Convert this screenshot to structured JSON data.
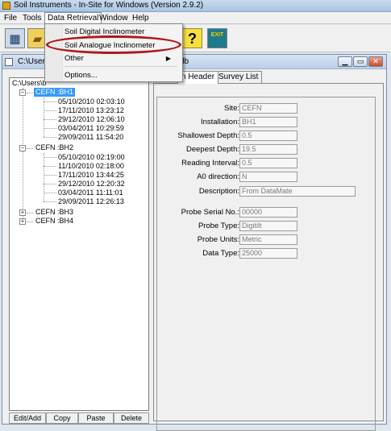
{
  "window": {
    "title": "Soil Instruments - In-Site for Windows (Version 2.9.2)"
  },
  "menubar": {
    "items": [
      "File",
      "Tools",
      "Data Retrieval",
      "Window",
      "Help"
    ]
  },
  "dropdown": {
    "items": [
      "Soil Digital Inclinometer",
      "Soil Analogue Inclinometer",
      "Other",
      "Options..."
    ]
  },
  "toolbar": {
    "exit_label": "EXIT"
  },
  "child_window": {
    "title": "C:\\Users\\",
    "title_suffix": "db"
  },
  "tabs": [
    "n Header",
    "Survey List"
  ],
  "tree": {
    "root": "C:\\Users\\b",
    "nodes": [
      {
        "label": "CEFN :BH1",
        "dates": [
          "05/10/2010 02:03:10",
          "17/11/2010 13:23:12",
          "29/12/2010 12:06:10",
          "03/04/2011 10:29:59",
          "29/09/2011 11:54:20"
        ]
      },
      {
        "label": "CEFN :BH2",
        "dates": [
          "05/10/2010 02:19:00",
          "11/10/2010 02:18:00",
          "17/11/2010 13:44:25",
          "29/12/2010 12:20:32",
          "03/04/2011 11:11:01",
          "29/09/2011 12:26:13"
        ]
      },
      {
        "label": "CEFN :BH3"
      },
      {
        "label": "CEFN :BH4"
      }
    ]
  },
  "header_form": {
    "site": {
      "label": "Site:",
      "value": "CEFN"
    },
    "installation": {
      "label": "Installation:",
      "value": "BH1"
    },
    "shallowest": {
      "label": "Shallowest Depth:",
      "value": "0.5"
    },
    "deepest": {
      "label": "Deepest Depth:",
      "value": "19.5"
    },
    "interval": {
      "label": "Reading Interval:",
      "value": "0.5"
    },
    "a0": {
      "label": "A0 direction:",
      "value": "N"
    },
    "description": {
      "label": "Description:",
      "value": "From DataMate"
    },
    "probe_serial": {
      "label": "Probe Serial No.:",
      "value": "00000"
    },
    "probe_type": {
      "label": "Probe Type:",
      "value": "Digitilt"
    },
    "probe_units": {
      "label": "Probe Units:",
      "value": "Metric"
    },
    "data_type": {
      "label": "Data Type:",
      "value": "25000"
    }
  },
  "buttons": [
    "Edit/Add",
    "Copy",
    "Paste",
    "Delete"
  ],
  "colors": {
    "highlight_ring": "#b01818",
    "selection": "#3399ff",
    "titlebar": "#b9cfe8"
  },
  "icons": [
    "app-icon",
    "calculator-icon",
    "folder-icon",
    "help-icon",
    "exit-icon",
    "minimize-icon",
    "restore-icon",
    "close-icon"
  ]
}
